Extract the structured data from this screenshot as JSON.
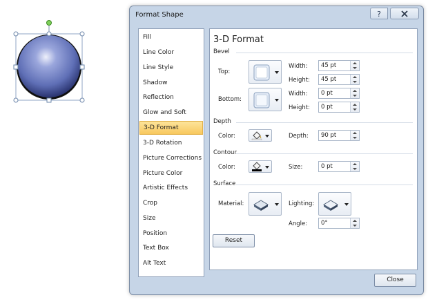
{
  "dialog": {
    "title": "Format Shape",
    "help_icon": "help-icon",
    "close_icon": "close-icon"
  },
  "categories": [
    "Fill",
    "Line Color",
    "Line Style",
    "Shadow",
    "Reflection",
    "Glow and Soft Edges",
    "3-D Format",
    "3-D Rotation",
    "Picture Corrections",
    "Picture Color",
    "Artistic Effects",
    "Crop",
    "Size",
    "Position",
    "Text Box",
    "Alt Text"
  ],
  "selected_category": "3-D Format",
  "panel": {
    "title": "3-D Format",
    "bevel": {
      "section_label": "Bevel",
      "top_label": "Top:",
      "bottom_label": "Bottom:",
      "top_width_label": "Width:",
      "top_width": "45 pt",
      "top_height_label": "Height:",
      "top_height": "45 pt",
      "bottom_width_label": "Width:",
      "bottom_width": "0 pt",
      "bottom_height_label": "Height:",
      "bottom_height": "0 pt"
    },
    "depth": {
      "section_label": "Depth",
      "color_label": "Color:",
      "depth_label": "Depth:",
      "depth_value": "90 pt"
    },
    "contour": {
      "section_label": "Contour",
      "color_label": "Color:",
      "size_label": "Size:",
      "size_value": "0 pt"
    },
    "surface": {
      "section_label": "Surface",
      "material_label": "Material:",
      "lighting_label": "Lighting:",
      "angle_label": "Angle:",
      "angle_value": "0°"
    },
    "reset_label": "Reset"
  },
  "close_label": "Close",
  "colors": {
    "dialog_bg": "#c6d5e7",
    "selected_item": "#f8c85e",
    "sphere": "#6f7fc4"
  }
}
